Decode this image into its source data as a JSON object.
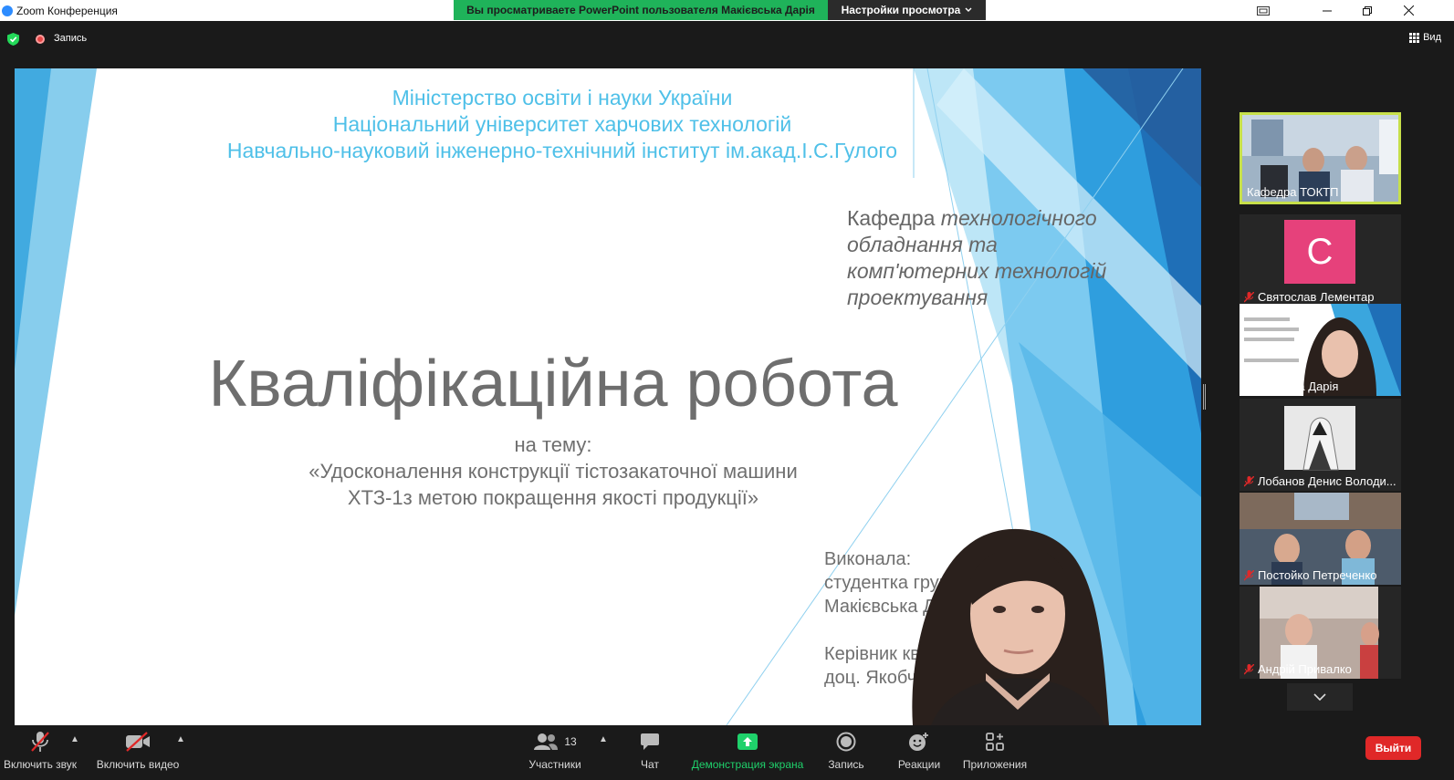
{
  "window": {
    "title": "Zoom Конференция",
    "share_banner": "Вы просматриваете PowerPoint пользователя Макієвська Дарія",
    "view_options": "Настройки просмотра",
    "view_options_icon": "chevron-down-icon"
  },
  "meeting_header": {
    "recording_label": "Запись",
    "view_label": "Вид"
  },
  "slide": {
    "ministry_lines": [
      "Міністерство освіти і науки України",
      "Національний університет харчових технологій",
      "Навчально-науковий інженерно-технічний інститут ім.акад.І.С.Гулого"
    ],
    "department_prefix": "Кафедра",
    "department_lines": [
      "технологічного",
      "обладнання та",
      "комп'ютерних технологій",
      "проектування"
    ],
    "title": "Кваліфікаційна робота",
    "topic_lines": [
      "на тему:",
      "«Удосконалення конструкції тістозакаточної машини",
      "ХТЗ-1з метою покращення якості продукції»"
    ],
    "author_lines": [
      "Виконала:",
      "студентка групи",
      "Макієвська Дарія",
      "",
      "Керівник кваліфікаційної роботи:",
      "доц. Якобчук"
    ]
  },
  "participants_panel": {
    "thumbnails": [
      {
        "name": "Кафедра ТОКТП",
        "muted": false,
        "active_speaker": true
      },
      {
        "name": "Святослав Лементар",
        "muted": true,
        "avatar_letter": "C"
      },
      {
        "name": "Макієвська Дарія",
        "muted": false
      },
      {
        "name": "Лобанов Денис Володи...",
        "muted": true
      },
      {
        "name": "Постойко Петреченко",
        "muted": true
      },
      {
        "name": "Андрій Привалко",
        "muted": true
      }
    ],
    "scroll_icon": "chevron-down-icon"
  },
  "toolbar": {
    "audio_label": "Включить звук",
    "video_label": "Включить видео",
    "participants_label": "Участники",
    "participants_count": "13",
    "chat_label": "Чат",
    "share_label": "Демонстрация экрана",
    "record_label": "Запись",
    "reactions_label": "Реакции",
    "apps_label": "Приложения",
    "leave_label": "Выйти"
  },
  "colors": {
    "share_banner": "#1fb35a",
    "leave_button": "#e02828",
    "slide_accent": "#4fc0e8",
    "active_speaker_border": "#c7e04a",
    "avatar_pink": "#e6417b"
  }
}
